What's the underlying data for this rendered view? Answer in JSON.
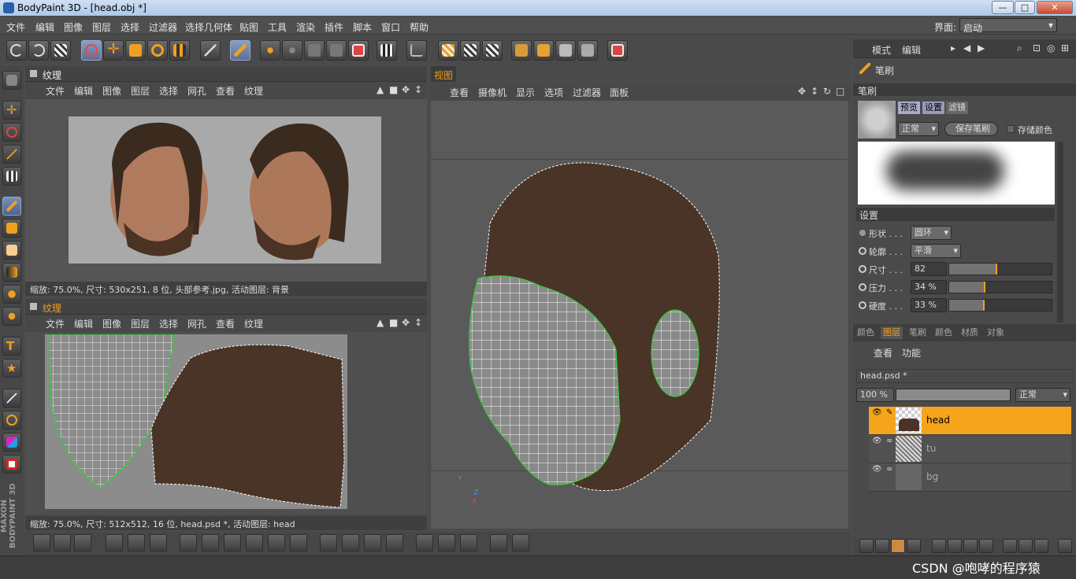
{
  "window": {
    "title": "BodyPaint 3D - [head.obj *]",
    "minimize": "—",
    "maximize": "□",
    "close": "✕"
  },
  "menu": [
    "文件",
    "编辑",
    "图像",
    "图层",
    "选择",
    "过滤器",
    "选择几何体",
    "贴图",
    "工具",
    "渲染",
    "插件",
    "脚本",
    "窗口",
    "帮助"
  ],
  "layout": {
    "label": "界面:",
    "value": "启动"
  },
  "texture_panel_top": {
    "title": "纹理",
    "menu": [
      "文件",
      "编辑",
      "图像",
      "图层",
      "选择",
      "网孔",
      "查看",
      "纹理"
    ],
    "status": "缩放: 75.0%, 尺寸: 530x251, 8 位, 头部参考.jpg, 活动图层: 背景"
  },
  "texture_panel_bottom": {
    "title": "纹理",
    "menu": [
      "文件",
      "编辑",
      "图像",
      "图层",
      "选择",
      "网孔",
      "查看",
      "纹理"
    ],
    "status": "缩放: 75.0%, 尺寸: 512x512, 16 位, head.psd *, 活动图层: head"
  },
  "viewport": {
    "tab": "视图",
    "menu": [
      "查看",
      "摄像机",
      "显示",
      "选项",
      "过滤器",
      "面板"
    ],
    "axes": {
      "x": "X",
      "y": "Y",
      "z": "Z"
    }
  },
  "attr_header": {
    "mode": "模式",
    "edit": "编辑"
  },
  "brush_panel": {
    "title": "笔刷",
    "section": "笔刷",
    "tabs": [
      "预览",
      "设置",
      "滤镜"
    ],
    "blend_mode": "正常",
    "save_button": "保存笔刷",
    "store_color_label": "存储颜色",
    "settings_title": "设置",
    "shape_label": "形状 . . .",
    "shape_value": "圆环",
    "profile_label": "轮廓 . . .",
    "profile_value": "平滑",
    "size_label": "尺寸 . . .",
    "size_value": "82",
    "size_level": 0.45,
    "pressure_label": "压力 . . .",
    "pressure_value": "34 %",
    "pressure_level": 0.34,
    "hardness_label": "硬度 . . .",
    "hardness_value": "33 %",
    "hardness_level": 0.33
  },
  "layers_panel": {
    "tabs": [
      "颜色",
      "图层",
      "笔刷",
      "颜色",
      "材质",
      "对象"
    ],
    "active_tab": "图层",
    "menu": [
      "查看",
      "功能"
    ],
    "file": "head.psd *",
    "opacity": "100 %",
    "opacity_level": 1.0,
    "blend": "正常",
    "layers": [
      {
        "name": "head",
        "selected": true
      },
      {
        "name": "tu",
        "selected": false
      },
      {
        "name": "bg",
        "selected": false
      }
    ]
  },
  "brand": "MAXON BODYPAINT 3D",
  "watermark": "CSDN @咆哮的程序猿",
  "colors": {
    "accent": "#f5a51c",
    "skin_brown": "#4a3427",
    "mesh_grey": "#8a8a8a",
    "panel": "#4c4c4c"
  }
}
